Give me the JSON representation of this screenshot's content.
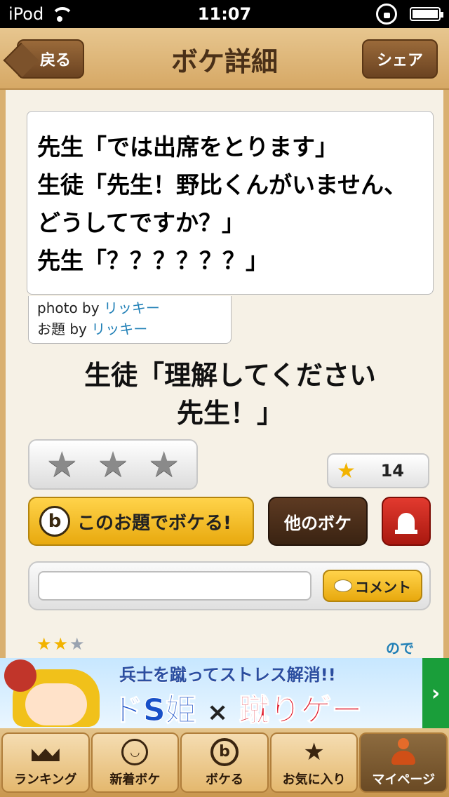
{
  "status": {
    "carrier": "iPod",
    "time": "11:07"
  },
  "nav": {
    "back_label": "戻る",
    "title": "ボケ詳細",
    "share_label": "シェア"
  },
  "photo": {
    "lines": [
      "先生「では出席をとります」",
      "生徒「先生！野比くんがいません、",
      "どうしてですか？」",
      "先生「？？？？？？」"
    ]
  },
  "credits": {
    "photo_prefix": "photo by ",
    "photo_author": "リッキー",
    "topic_prefix": "お題 by ",
    "topic_author": "リッキー"
  },
  "caption": {
    "line1": "生徒「理解してください",
    "line2": "先生！」"
  },
  "rating": {
    "count": "14"
  },
  "actions": {
    "boke_label": "このお題でボケる!",
    "b_icon": "b",
    "other_label": "他のボケ",
    "report_icon": "siren-icon"
  },
  "comment": {
    "placeholder": "",
    "button_label": "コメント"
  },
  "partial": {
    "link": "ので"
  },
  "ad": {
    "top_text": "兵士を蹴ってストレス解消!!",
    "main_left": "ドS姫",
    "main_x": "×",
    "main_right": "蹴りゲー",
    "arrow": "›"
  },
  "tabs": [
    {
      "label": "ランキング",
      "icon": "crown-icon"
    },
    {
      "label": "新着ボケ",
      "icon": "face-icon"
    },
    {
      "label": "ボケる",
      "icon": "b-icon",
      "glyph": "b"
    },
    {
      "label": "お気に入り",
      "icon": "star-icon",
      "glyph": "★"
    },
    {
      "label": "マイページ",
      "icon": "user-icon"
    }
  ]
}
